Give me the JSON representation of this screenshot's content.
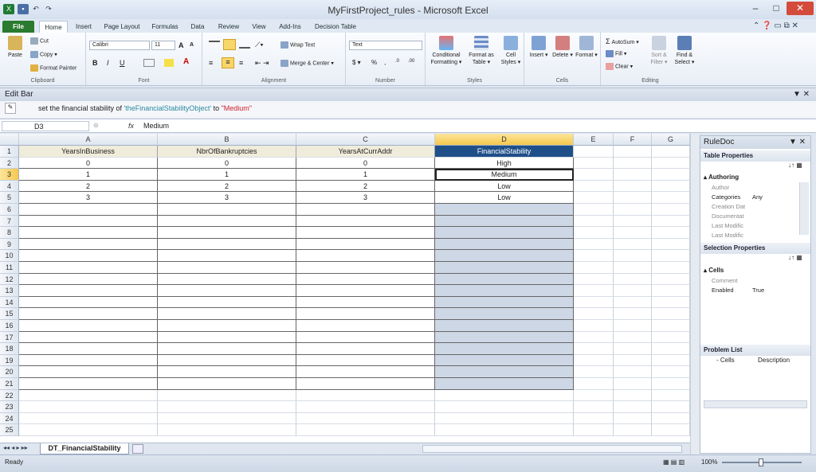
{
  "window": {
    "title": "MyFirstProject_rules - Microsoft Excel",
    "controls": [
      "–",
      "□",
      "✕"
    ]
  },
  "ribbon_tabs": [
    "File",
    "Home",
    "Insert",
    "Page Layout",
    "Formulas",
    "Data",
    "Review",
    "View",
    "Add-Ins",
    "Decision Table"
  ],
  "clipboard": {
    "paste": "Paste",
    "cut": "Cut",
    "copy": "Copy ▾",
    "format_painter": "Format Painter",
    "group": "Clipboard"
  },
  "font": {
    "name": "Calibri",
    "size": "11",
    "grow": "A",
    "shrink": "A",
    "bold": "B",
    "italic": "I",
    "underline": "U",
    "group": "Font"
  },
  "alignment": {
    "wrap": "Wrap Text",
    "merge": "Merge & Center ▾",
    "group": "Alignment"
  },
  "number": {
    "format": "Text",
    "currency": "$ ▾",
    "percent": "%",
    "comma": ",",
    "inc": ".0",
    "dec": ".00",
    "group": "Number"
  },
  "styles": {
    "cond": "Conditional Formatting ▾",
    "table": "Format as Table ▾",
    "cell": "Cell Styles ▾",
    "group": "Styles"
  },
  "cells": {
    "insert": "Insert ▾",
    "delete": "Delete ▾",
    "format": "Format ▾",
    "group": "Cells"
  },
  "editing": {
    "autosum": "AutoSum ▾",
    "fill": "Fill ▾",
    "clear": "Clear ▾",
    "sort": "Sort & Filter ▾",
    "find": "Find & Select ▾",
    "group": "Editing"
  },
  "edit_bar": {
    "title": "Edit Bar",
    "rule_pre": "set the financial stability of ",
    "rule_obj": "'theFinancialStabilityObject'",
    "rule_mid": " to ",
    "rule_val": "\"Medium\""
  },
  "formula_bar": {
    "name_box": "D3",
    "fx": "fx",
    "value": "Medium"
  },
  "columns": [
    "A",
    "B",
    "C",
    "D",
    "E",
    "F",
    "G"
  ],
  "rows": [
    "1",
    "2",
    "3",
    "4",
    "5",
    "6",
    "7",
    "8",
    "9",
    "10",
    "11",
    "12",
    "13",
    "14",
    "15",
    "16",
    "17",
    "18",
    "19",
    "20",
    "21",
    "22",
    "23",
    "24",
    "25"
  ],
  "headers": [
    "YearsInBusiness",
    "NbrOfBankruptcies",
    "YearsAtCurrAddr",
    "FinancialStability"
  ],
  "table_rows": [
    [
      "0",
      "0",
      "0",
      "High"
    ],
    [
      "1",
      "1",
      "1",
      "Medium"
    ],
    [
      "2",
      "2",
      "2",
      "Low"
    ],
    [
      "3",
      "3",
      "3",
      "Low"
    ]
  ],
  "sheet_tab": "DT_FinancialStability",
  "status": {
    "left": "Ready",
    "zoom": "100%"
  },
  "rule_doc": {
    "title": "RuleDoc",
    "table_properties": "Table Properties",
    "authoring": "Authoring",
    "table_props": [
      [
        "Author",
        ""
      ],
      [
        "Categories",
        "Any"
      ],
      [
        "Creation Dat",
        ""
      ],
      [
        "Documentat",
        ""
      ],
      [
        "Last Modific",
        ""
      ],
      [
        "Last Modific",
        ""
      ]
    ],
    "selection_properties": "Selection Properties",
    "cells_section": "Cells",
    "selection_props": [
      [
        "Comment",
        ""
      ],
      [
        "Enabled",
        "True"
      ]
    ],
    "problem_list": "Problem List",
    "problem_cols": [
      "- Cells",
      "Description"
    ]
  },
  "colors": {
    "accent": "#1f4f88",
    "file_tab": "#2a7a2f",
    "header_fill": "#f0ecdb",
    "shade": "#cdd7e6"
  }
}
